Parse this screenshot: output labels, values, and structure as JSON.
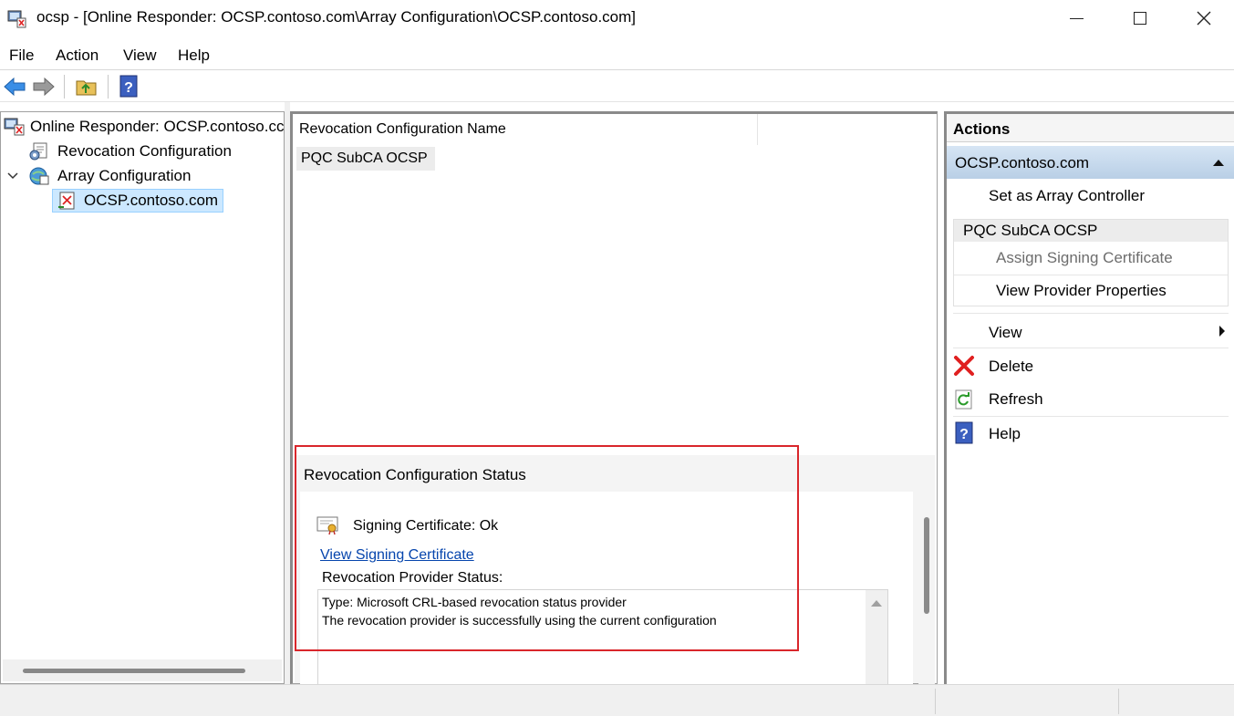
{
  "window": {
    "title": "ocsp - [Online Responder: OCSP.contoso.com\\Array Configuration\\OCSP.contoso.com]"
  },
  "menu": {
    "items": [
      "File",
      "Action",
      "View",
      "Help"
    ]
  },
  "tree": {
    "root": "Online Responder: OCSP.contoso.cc",
    "revocation": "Revocation Configuration",
    "array": "Array Configuration",
    "selected": "OCSP.contoso.com"
  },
  "list": {
    "column": "Revocation Configuration Name",
    "row": "PQC SubCA OCSP"
  },
  "status": {
    "heading": "Revocation Configuration Status",
    "signing": "Signing Certificate: Ok",
    "view_link": "View Signing Certificate",
    "provider_label": "Revocation Provider Status:",
    "provider_line1": "Type: Microsoft CRL-based revocation status provider",
    "provider_line2": "The revocation provider is successfully using the current configuration"
  },
  "actions": {
    "header": "Actions",
    "section1": "OCSP.contoso.com",
    "set_controller": "Set as Array Controller",
    "section2": "PQC SubCA OCSP",
    "assign_cert": "Assign Signing Certificate",
    "view_provider": "View Provider Properties",
    "view": "View",
    "delete": "Delete",
    "refresh": "Refresh",
    "help": "Help"
  },
  "colors": {
    "highlight_box": "#d9262b",
    "link": "#0645ad",
    "section_header": "#c6d9ec",
    "selection": "#cce8ff"
  }
}
